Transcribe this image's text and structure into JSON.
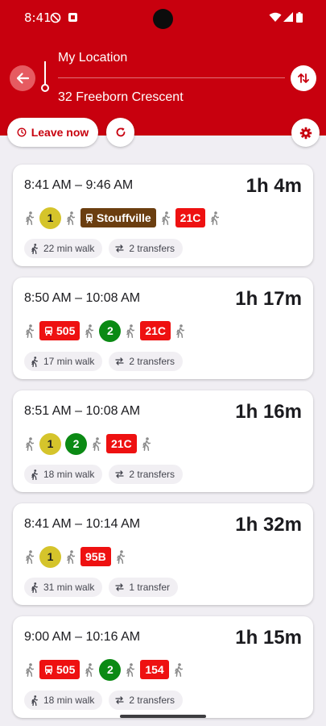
{
  "status": {
    "time": "8:41"
  },
  "header": {
    "from": "My Location",
    "to": "32 Freeborn Crescent",
    "leave_label": "Leave now"
  },
  "icons": {
    "back": "arrow-left-icon",
    "swap": "swap-vertical-icon",
    "clock": "clock-icon",
    "refresh": "refresh-icon",
    "settings": "gear-icon",
    "walk": "walk-icon",
    "transfer": "transfer-icon",
    "bus": "bus-icon",
    "train": "train-icon"
  },
  "colors": {
    "brand": "#c8000e",
    "line1": "#d5c42b",
    "line2": "#0b8a14",
    "bus": "#ee1111",
    "go_train": "#6b3e10"
  },
  "trips": [
    {
      "time_range": "8:41 AM – 9:46 AM",
      "duration": "1h 4m",
      "walk": "22 min walk",
      "transfers": "2 transfers",
      "legs": [
        {
          "kind": "walk"
        },
        {
          "kind": "circle",
          "label": "1",
          "bg": "#d5c42b",
          "fg": "#1b1b1f"
        },
        {
          "kind": "walk"
        },
        {
          "kind": "rect",
          "label": "Stouffville",
          "bg": "#6b3e10",
          "icon": "train"
        },
        {
          "kind": "walk"
        },
        {
          "kind": "rect",
          "label": "21C",
          "bg": "#ee1111"
        },
        {
          "kind": "walk"
        }
      ]
    },
    {
      "time_range": "8:50 AM – 10:08 AM",
      "duration": "1h 17m",
      "walk": "17 min walk",
      "transfers": "2 transfers",
      "legs": [
        {
          "kind": "walk"
        },
        {
          "kind": "rect",
          "label": "505",
          "bg": "#ee1111",
          "icon": "bus"
        },
        {
          "kind": "walk"
        },
        {
          "kind": "circle",
          "label": "2",
          "bg": "#0b8a14",
          "fg": "#ffffff"
        },
        {
          "kind": "walk"
        },
        {
          "kind": "rect",
          "label": "21C",
          "bg": "#ee1111"
        },
        {
          "kind": "walk"
        }
      ]
    },
    {
      "time_range": "8:51 AM – 10:08 AM",
      "duration": "1h 16m",
      "walk": "18 min walk",
      "transfers": "2 transfers",
      "legs": [
        {
          "kind": "walk"
        },
        {
          "kind": "circle",
          "label": "1",
          "bg": "#d5c42b",
          "fg": "#1b1b1f"
        },
        {
          "kind": "circle",
          "label": "2",
          "bg": "#0b8a14",
          "fg": "#ffffff"
        },
        {
          "kind": "walk"
        },
        {
          "kind": "rect",
          "label": "21C",
          "bg": "#ee1111"
        },
        {
          "kind": "walk"
        }
      ]
    },
    {
      "time_range": "8:41 AM – 10:14 AM",
      "duration": "1h 32m",
      "walk": "31 min walk",
      "transfers": "1 transfer",
      "legs": [
        {
          "kind": "walk"
        },
        {
          "kind": "circle",
          "label": "1",
          "bg": "#d5c42b",
          "fg": "#1b1b1f"
        },
        {
          "kind": "walk"
        },
        {
          "kind": "rect",
          "label": "95B",
          "bg": "#ee1111"
        },
        {
          "kind": "walk"
        }
      ]
    },
    {
      "time_range": "9:00 AM – 10:16 AM",
      "duration": "1h 15m",
      "walk": "18 min walk",
      "transfers": "2 transfers",
      "legs": [
        {
          "kind": "walk"
        },
        {
          "kind": "rect",
          "label": "505",
          "bg": "#ee1111",
          "icon": "bus"
        },
        {
          "kind": "walk"
        },
        {
          "kind": "circle",
          "label": "2",
          "bg": "#0b8a14",
          "fg": "#ffffff"
        },
        {
          "kind": "walk"
        },
        {
          "kind": "rect",
          "label": "154",
          "bg": "#ee1111"
        },
        {
          "kind": "walk"
        }
      ]
    }
  ]
}
